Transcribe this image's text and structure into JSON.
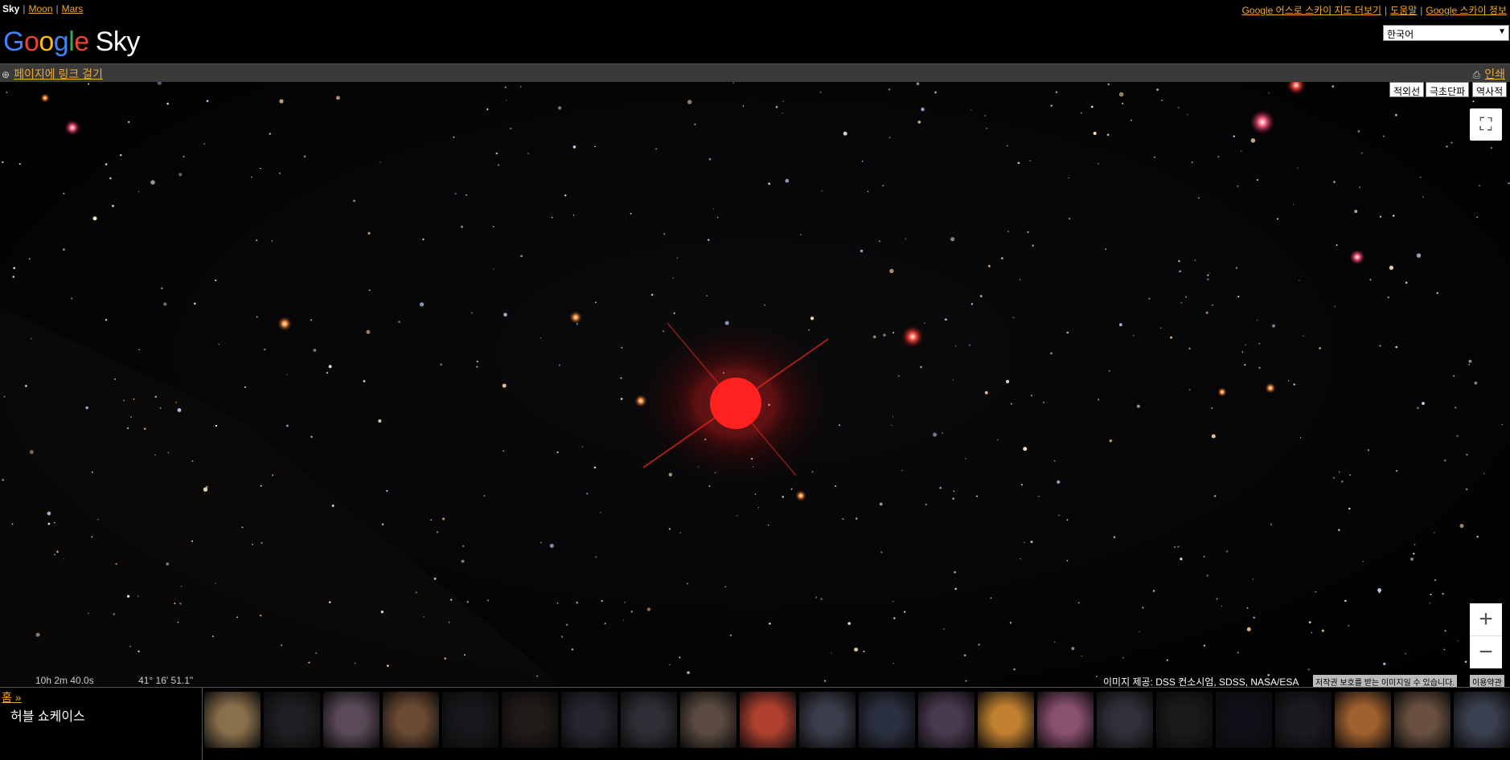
{
  "top_nav": {
    "sky": "Sky",
    "moon": "Moon",
    "mars": "Mars",
    "earth_link": "Google 어스로 스카이 지도 더보기",
    "help": "도움말",
    "about": "Google 스카이 정보"
  },
  "logo": {
    "google": "Google",
    "sky": "Sky"
  },
  "language": {
    "selected": "한국어"
  },
  "link_bar": {
    "link_page": "페이지에 링크 걸기",
    "print": "인쇄"
  },
  "map_controls": {
    "infrared": "적외선",
    "microwave": "극초단파",
    "historical": "역사적"
  },
  "coordinates": {
    "ra": "10h 2m 40.0s",
    "dec": "41° 16' 51.1\""
  },
  "credits": {
    "image": "이미지 제공: DSS 컨소시엄, SDSS, NASA/ESA",
    "copyright": "저작권 보호를 받는 이미지일 수 있습니다.",
    "terms": "이용약관"
  },
  "bottom": {
    "home": "홈 »",
    "showcase": "허블 쇼케이스",
    "thumbnail_colors": [
      "#8a6f4c",
      "#1e1e22",
      "#5a4a58",
      "#6b4a34",
      "#18161a",
      "#201a18",
      "#252530",
      "#2e2e36",
      "#5a4a40",
      "#b04030",
      "#3a3c4a",
      "#2a3040",
      "#4a3a50",
      "#c08030",
      "#8a5070",
      "#30303a",
      "#1a1a1a",
      "#101018",
      "#1a1a20",
      "#a06030",
      "#6a5040",
      "#3a4050"
    ]
  }
}
